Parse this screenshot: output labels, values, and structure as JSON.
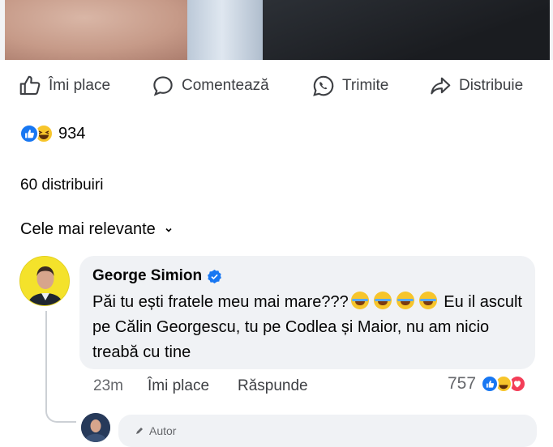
{
  "post_actions": {
    "like": "Îmi place",
    "comment": "Comentează",
    "send": "Trimite",
    "share": "Distribuie"
  },
  "reactions": {
    "count": "934",
    "icons": [
      "like-icon",
      "haha-icon"
    ]
  },
  "shares_text": "60 distribuiri",
  "sort_label": "Cele mai relevante",
  "comment": {
    "author": "George Simion",
    "verified": true,
    "text_before": "Păi tu ești fratele meu mai mare???",
    "emoji": [
      "face-with-tears-of-joy",
      "face-with-tears-of-joy",
      "face-with-tears-of-joy",
      "face-with-tears-of-joy"
    ],
    "text_after": " Eu il ascult pe Călin Georgescu, tu pe Codlea și Maior, nu am nicio treabă cu tine",
    "time": "23m",
    "like_label": "Îmi place",
    "reply_label": "Răspunde",
    "reaction_count": "757",
    "reaction_icons": [
      "like-icon",
      "haha-icon",
      "love-icon"
    ]
  },
  "reply": {
    "tag": "Autor"
  },
  "colors": {
    "accent": "#1877f2",
    "bubble": "#f0f2f5",
    "muted": "#65676b",
    "haha": "#f7c52b",
    "love": "#f33e58"
  }
}
